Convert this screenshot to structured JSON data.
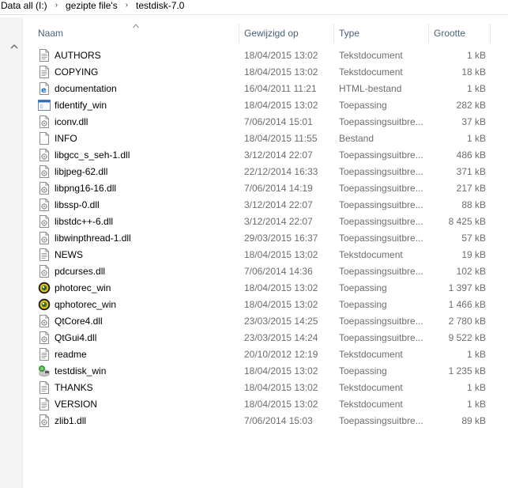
{
  "breadcrumb": {
    "items": [
      "Data all (I:)",
      "gezipte file's",
      "testdisk-7.0"
    ],
    "separator": "›"
  },
  "columns": {
    "name": "Naam",
    "modified": "Gewijzigd op",
    "type": "Type",
    "size": "Grootte"
  },
  "files": [
    {
      "name": "AUTHORS",
      "modified": "18/04/2015 13:02",
      "type": "Tekstdocument",
      "size": "1 kB",
      "icon": "text-file-icon"
    },
    {
      "name": "COPYING",
      "modified": "18/04/2015 13:02",
      "type": "Tekstdocument",
      "size": "18 kB",
      "icon": "text-file-icon"
    },
    {
      "name": "documentation",
      "modified": "16/04/2011 11:21",
      "type": "HTML-bestand",
      "size": "1 kB",
      "icon": "html-file-icon"
    },
    {
      "name": "fidentify_win",
      "modified": "18/04/2015 13:02",
      "type": "Toepassing",
      "size": "282 kB",
      "icon": "application-icon"
    },
    {
      "name": "iconv.dll",
      "modified": "7/06/2014 15:01",
      "type": "Toepassingsuitbre...",
      "size": "37 kB",
      "icon": "dll-file-icon"
    },
    {
      "name": "INFO",
      "modified": "18/04/2015 11:55",
      "type": "Bestand",
      "size": "1 kB",
      "icon": "blank-file-icon"
    },
    {
      "name": "libgcc_s_seh-1.dll",
      "modified": "3/12/2014 22:07",
      "type": "Toepassingsuitbre...",
      "size": "486 kB",
      "icon": "dll-file-icon"
    },
    {
      "name": "libjpeg-62.dll",
      "modified": "22/12/2014 16:33",
      "type": "Toepassingsuitbre...",
      "size": "371 kB",
      "icon": "dll-file-icon"
    },
    {
      "name": "libpng16-16.dll",
      "modified": "7/06/2014 14:19",
      "type": "Toepassingsuitbre...",
      "size": "217 kB",
      "icon": "dll-file-icon"
    },
    {
      "name": "libssp-0.dll",
      "modified": "3/12/2014 22:07",
      "type": "Toepassingsuitbre...",
      "size": "88 kB",
      "icon": "dll-file-icon"
    },
    {
      "name": "libstdc++-6.dll",
      "modified": "3/12/2014 22:07",
      "type": "Toepassingsuitbre...",
      "size": "8 425 kB",
      "icon": "dll-file-icon"
    },
    {
      "name": "libwinpthread-1.dll",
      "modified": "29/03/2015 16:37",
      "type": "Toepassingsuitbre...",
      "size": "57 kB",
      "icon": "dll-file-icon"
    },
    {
      "name": "NEWS",
      "modified": "18/04/2015 13:02",
      "type": "Tekstdocument",
      "size": "19 kB",
      "icon": "text-file-icon"
    },
    {
      "name": "pdcurses.dll",
      "modified": "7/06/2014 14:36",
      "type": "Toepassingsuitbre...",
      "size": "102 kB",
      "icon": "dll-file-icon"
    },
    {
      "name": "photorec_win",
      "modified": "18/04/2015 13:02",
      "type": "Toepassing",
      "size": "1 397 kB",
      "icon": "photorec-app-icon"
    },
    {
      "name": "qphotorec_win",
      "modified": "18/04/2015 13:02",
      "type": "Toepassing",
      "size": "1 466 kB",
      "icon": "photorec-app-icon"
    },
    {
      "name": "QtCore4.dll",
      "modified": "23/03/2015 14:25",
      "type": "Toepassingsuitbre...",
      "size": "2 780 kB",
      "icon": "dll-file-icon"
    },
    {
      "name": "QtGui4.dll",
      "modified": "23/03/2015 14:24",
      "type": "Toepassingsuitbre...",
      "size": "9 522 kB",
      "icon": "dll-file-icon"
    },
    {
      "name": "readme",
      "modified": "20/10/2012 12:19",
      "type": "Tekstdocument",
      "size": "1 kB",
      "icon": "text-file-icon"
    },
    {
      "name": "testdisk_win",
      "modified": "18/04/2015 13:02",
      "type": "Toepassing",
      "size": "1 235 kB",
      "icon": "testdisk-app-icon"
    },
    {
      "name": "THANKS",
      "modified": "18/04/2015 13:02",
      "type": "Tekstdocument",
      "size": "1 kB",
      "icon": "text-file-icon"
    },
    {
      "name": "VERSION",
      "modified": "18/04/2015 13:02",
      "type": "Tekstdocument",
      "size": "1 kB",
      "icon": "text-file-icon"
    },
    {
      "name": "zlib1.dll",
      "modified": "7/06/2014 15:03",
      "type": "Toepassingsuitbre...",
      "size": "89 kB",
      "icon": "dll-file-icon"
    }
  ]
}
